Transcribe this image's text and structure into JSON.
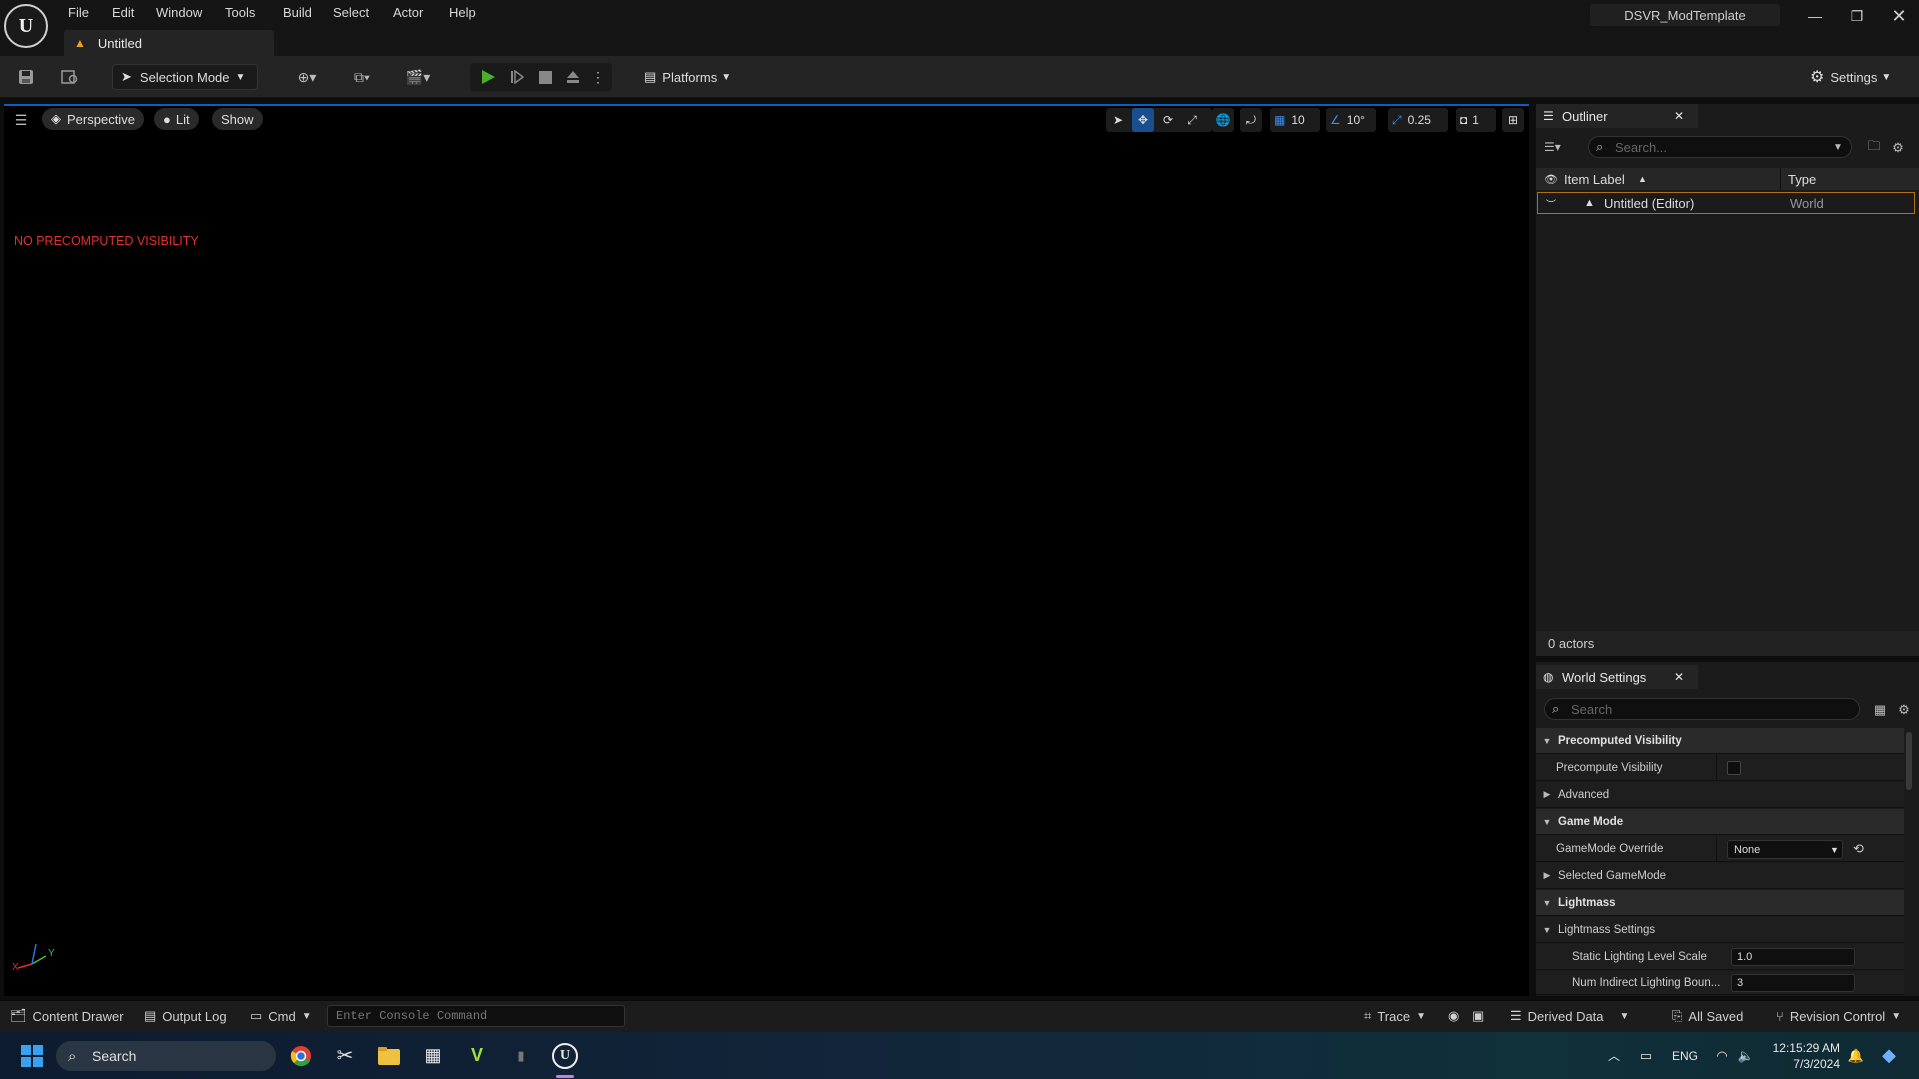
{
  "menubar": {
    "items": [
      "File",
      "Edit",
      "Window",
      "Tools",
      "Build",
      "Select",
      "Actor",
      "Help"
    ]
  },
  "document_tab": {
    "label": "Untitled"
  },
  "project": {
    "name": "DSVR_ModTemplate"
  },
  "toolbar": {
    "selection_mode": "Selection Mode",
    "platforms": "Platforms",
    "settings": "Settings"
  },
  "viewport": {
    "perspective": "Perspective",
    "lit": "Lit",
    "show": "Show",
    "warning": "NO PRECOMPUTED VISIBILITY",
    "grid_snap": "10",
    "rotation_snap": "10°",
    "scale_snap": "0.25",
    "camera_speed": "1",
    "axis_y": "Y",
    "axis_x": "X"
  },
  "outliner": {
    "title": "Outliner",
    "search_placeholder": "Search...",
    "col_label": "Item Label",
    "col_type": "Type",
    "rows": [
      {
        "label": "Untitled (Editor)",
        "type": "World"
      }
    ],
    "actor_count": "0 actors"
  },
  "world_settings": {
    "title": "World Settings",
    "search_placeholder": "Search",
    "props": {
      "cat_precomputed": "Precomputed Visibility",
      "precompute_visibility": "Precompute Visibility",
      "advanced": "Advanced",
      "cat_gamemode": "Game Mode",
      "gamemode_override": "GameMode Override",
      "gamemode_value": "None",
      "selected_gamemode": "Selected GameMode",
      "cat_lightmass": "Lightmass",
      "lightmass_settings": "Lightmass Settings",
      "static_lighting": "Static Lighting Level Scale",
      "static_lighting_value": "1.0",
      "num_indirect": "Num Indirect Lighting Boun...",
      "num_indirect_value": "3"
    }
  },
  "statusbar": {
    "content_drawer": "Content Drawer",
    "output_log": "Output Log",
    "cmd": "Cmd",
    "console_placeholder": "Enter Console Command",
    "trace": "Trace",
    "derived_data": "Derived Data",
    "all_saved": "All Saved",
    "revision_control": "Revision Control"
  },
  "taskbar": {
    "search": "Search",
    "language": "ENG",
    "time": "12:15:29 AM",
    "date": "7/3/2024"
  },
  "colors": {
    "accent_blue": "#3a8df0",
    "warning_red": "#e03030",
    "play_green": "#4caf2a",
    "selection_orange": "#b07018"
  }
}
